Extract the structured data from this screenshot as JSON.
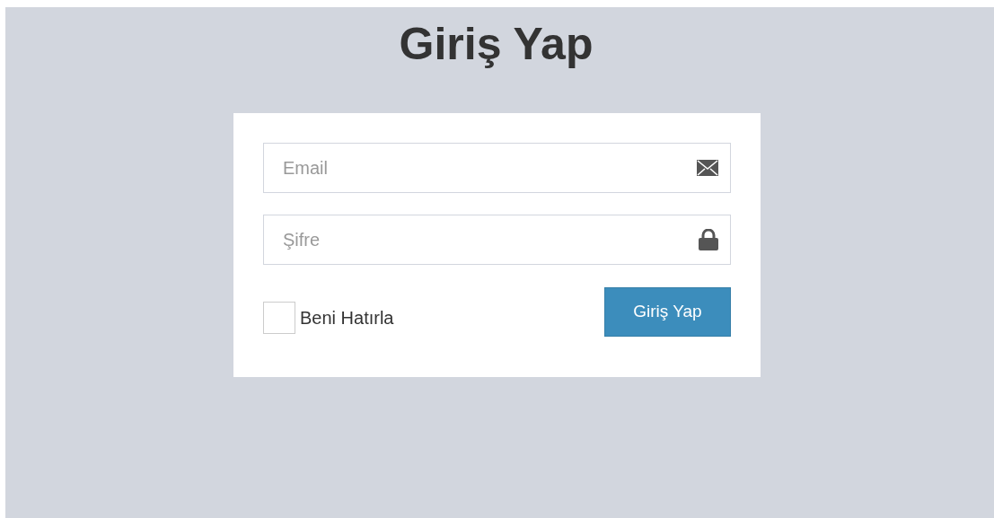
{
  "title": "Giriş Yap",
  "fields": [
    {
      "kind": "email",
      "placeholder": "Email"
    },
    {
      "kind": "password",
      "placeholder": "Şifre"
    }
  ],
  "remember": {
    "label": "Beni Hatırla",
    "checked": false
  },
  "submit": {
    "label": "Giriş Yap"
  }
}
